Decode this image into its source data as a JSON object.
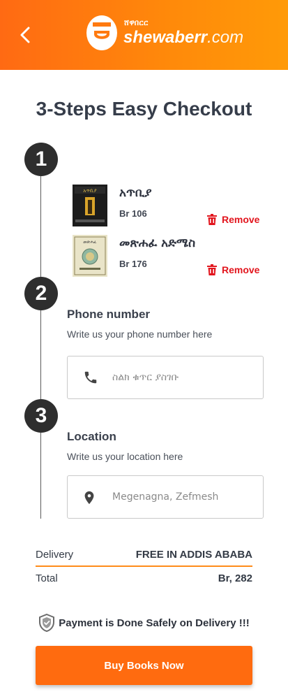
{
  "header": {
    "logo_sub": "ሸዋበርር",
    "logo_main_bold": "shewaberr",
    "logo_main_suffix": ".com",
    "back_icon": "chevron-left-icon",
    "gradient": [
      "#ff6a13",
      "#ff9a08"
    ]
  },
  "page_title": "3-Steps Easy Checkout",
  "steps": [
    "1",
    "2",
    "3"
  ],
  "cart": {
    "items": [
      {
        "title": "አጥቢያ",
        "price": "Br 106",
        "remove_label": "Remove"
      },
      {
        "title": "መጽሐፈ አድሜስ",
        "price": "Br 176",
        "remove_label": "Remove"
      }
    ]
  },
  "phone": {
    "label": "Phone number",
    "hint": "Write us your phone number here",
    "placeholder": "ስልክ ቁጥር ያስገቡ",
    "icon": "phone-icon"
  },
  "location": {
    "label": "Location",
    "hint": "Write us your location here",
    "placeholder": "Megenagna, Zefmesh",
    "icon": "location-pin-icon"
  },
  "summary": {
    "delivery_label": "Delivery",
    "delivery_value": "FREE IN ADDIS ABABA",
    "total_label": "Total",
    "total_value": "Br, 282"
  },
  "safe_note": "Payment is Done Safely on Delivery !!!",
  "buy_button": "Buy Books Now",
  "colors": {
    "accent": "#ff6b0f",
    "remove": "#e2161e",
    "divider": "#ff8c1a"
  }
}
